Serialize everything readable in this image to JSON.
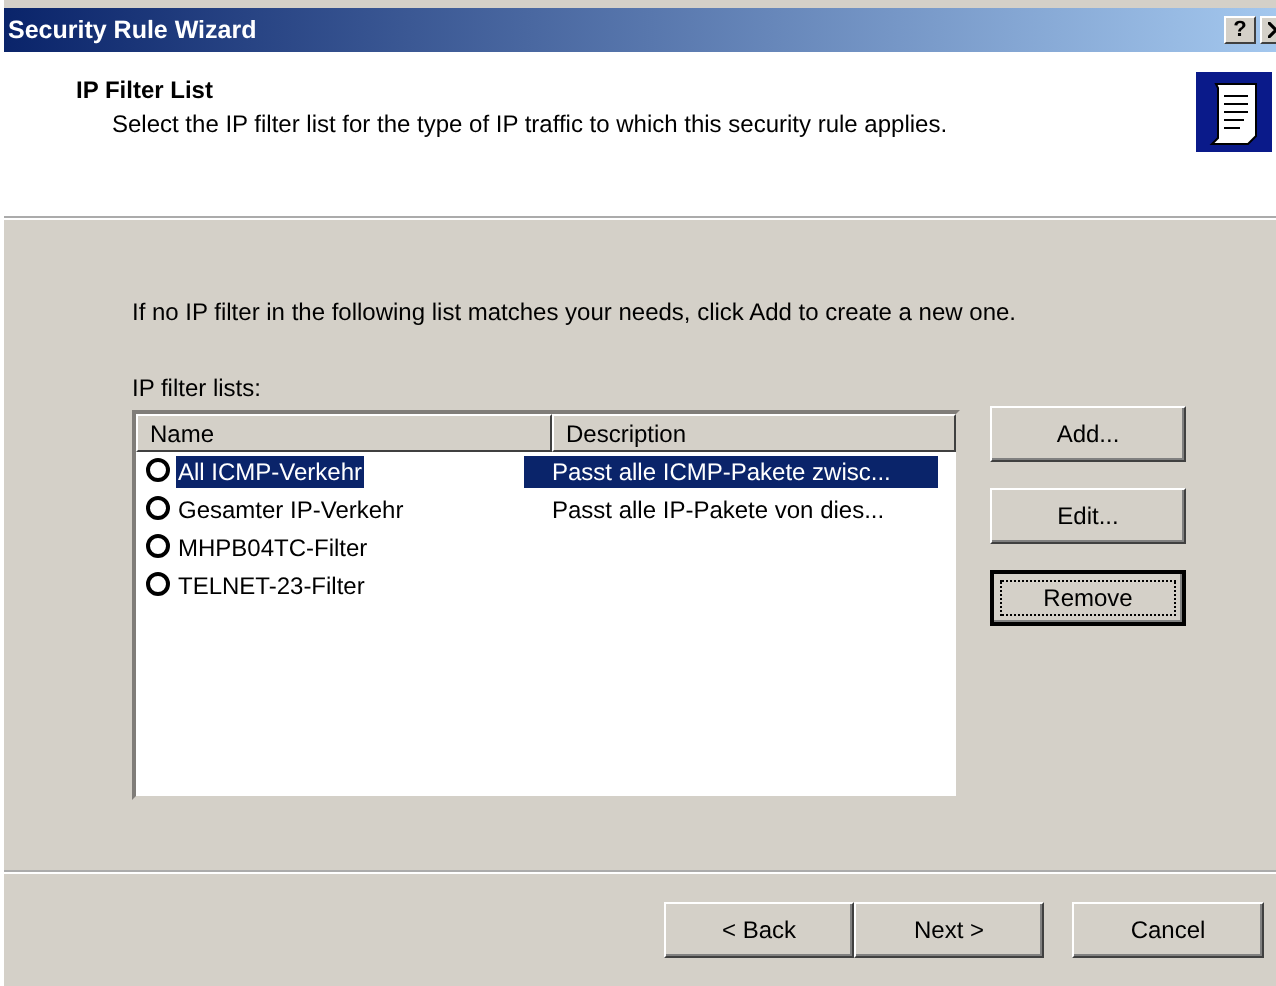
{
  "window": {
    "title": "Security Rule Wizard",
    "help_button": "?"
  },
  "header": {
    "title": "IP Filter List",
    "subtitle": "Select the IP filter list for the type of IP traffic to which this security rule applies."
  },
  "instruction": "If no IP filter in the following list matches your needs, click Add to create a new one.",
  "list_label": "IP filter lists:",
  "table": {
    "columns": [
      "Name",
      "Description"
    ],
    "rows": [
      {
        "name": "All ICMP-Verkehr",
        "description": "Passt alle ICMP-Pakete zwisc...",
        "selected": true
      },
      {
        "name": "Gesamter IP-Verkehr",
        "description": "Passt alle IP-Pakete von dies...",
        "selected": false
      },
      {
        "name": "MHPB04TC-Filter",
        "description": "",
        "selected": false
      },
      {
        "name": "TELNET-23-Filter",
        "description": "",
        "selected": false
      }
    ]
  },
  "side_buttons": [
    {
      "label": "Add...",
      "focused": false
    },
    {
      "label": "Edit...",
      "focused": false
    },
    {
      "label": "Remove",
      "focused": true
    }
  ],
  "footer_buttons": [
    {
      "label": "< Back",
      "focused": false
    },
    {
      "label": "Next >",
      "focused": false
    },
    {
      "label": "Cancel",
      "focused": false
    }
  ]
}
